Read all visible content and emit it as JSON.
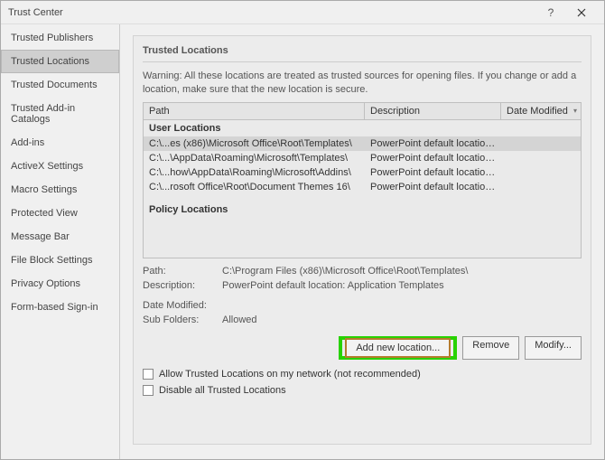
{
  "title": "Trust Center",
  "sidebar": {
    "items": [
      {
        "label": "Trusted Publishers"
      },
      {
        "label": "Trusted Locations"
      },
      {
        "label": "Trusted Documents"
      },
      {
        "label": "Trusted Add-in Catalogs"
      },
      {
        "label": "Add-ins"
      },
      {
        "label": "ActiveX Settings"
      },
      {
        "label": "Macro Settings"
      },
      {
        "label": "Protected View"
      },
      {
        "label": "Message Bar"
      },
      {
        "label": "File Block Settings"
      },
      {
        "label": "Privacy Options"
      },
      {
        "label": "Form-based Sign-in"
      }
    ],
    "selected_index": 1
  },
  "section": {
    "title": "Trusted Locations",
    "warning": "Warning: All these locations are treated as trusted sources for opening files.  If you change or add a location, make sure that the new location is secure."
  },
  "columns": {
    "path": "Path",
    "desc": "Description",
    "date": "Date Modified"
  },
  "groups": {
    "user": "User Locations",
    "policy": "Policy Locations"
  },
  "rows": [
    {
      "path": "C:\\...es (x86)\\Microsoft Office\\Root\\Templates\\",
      "desc": "PowerPoint default location: Application Tem...",
      "selected": true
    },
    {
      "path": "C:\\...\\AppData\\Roaming\\Microsoft\\Templates\\",
      "desc": "PowerPoint default location: Templates"
    },
    {
      "path": "C:\\...how\\AppData\\Roaming\\Microsoft\\Addins\\",
      "desc": "PowerPoint default location: Addins"
    },
    {
      "path": "C:\\...rosoft Office\\Root\\Document Themes 16\\",
      "desc": "PowerPoint default location: Application The..."
    }
  ],
  "details": {
    "path_label": "Path:",
    "path_value": "C:\\Program Files (x86)\\Microsoft Office\\Root\\Templates\\",
    "desc_label": "Description:",
    "desc_value": "PowerPoint default location: Application Templates",
    "date_label": "Date Modified:",
    "date_value": "",
    "sub_label": "Sub Folders:",
    "sub_value": "Allowed"
  },
  "buttons": {
    "add": "Add new location...",
    "remove": "Remove",
    "modify": "Modify..."
  },
  "checkboxes": {
    "allow_network": "Allow Trusted Locations on my network (not recommended)",
    "disable_all": "Disable all Trusted Locations"
  }
}
